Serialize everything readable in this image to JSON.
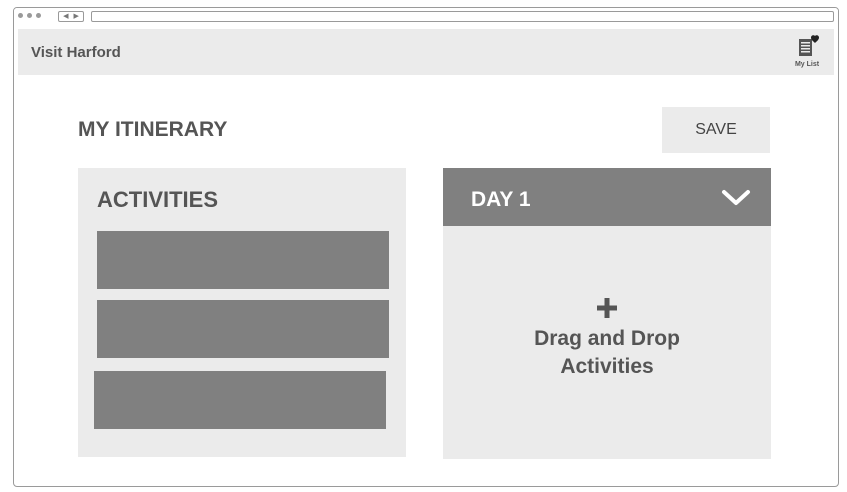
{
  "header": {
    "brand": "Visit Harford",
    "mylist_label": "My List",
    "mylist_icon": "list-heart-icon"
  },
  "main": {
    "title": "MY ITINERARY",
    "save_label": "SAVE"
  },
  "activities": {
    "title": "ACTIVITIES",
    "card_count": 3
  },
  "day": {
    "title": "DAY 1",
    "toggle_icon": "chevron-down-icon",
    "drop_icon": "plus-icon",
    "drop_text": "Drag and Drop Activities"
  },
  "colors": {
    "header_bg": "#ebebeb",
    "panel_bg": "#ebebeb",
    "card_fill": "#808080",
    "day_header_bg": "#808080",
    "text_dark": "#555555"
  }
}
